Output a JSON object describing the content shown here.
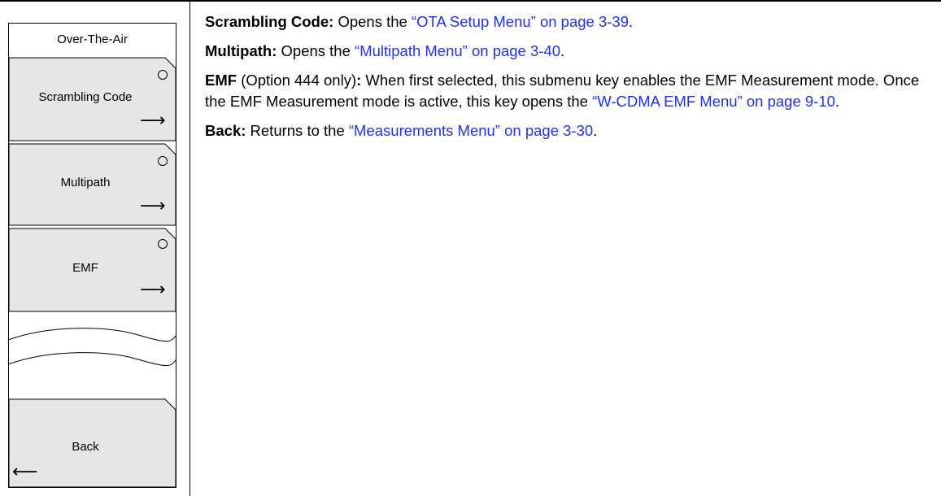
{
  "menu": {
    "title": "Over-The-Air",
    "keys": [
      {
        "label": "Scrambling Code",
        "arrow": "⟶"
      },
      {
        "label": "Multipath",
        "arrow": "⟶"
      },
      {
        "label": "EMF",
        "arrow": "⟶"
      }
    ],
    "back": {
      "label": "Back",
      "arrow": "⟵"
    }
  },
  "descriptions": {
    "scrambling": {
      "term": "Scrambling Code:",
      "text": " Opens the ",
      "link": "“OTA Setup Menu” on page 3-39",
      "end": "."
    },
    "multipath": {
      "term": "Multipath:",
      "text": " Opens the ",
      "link": "“Multipath Menu” on page 3-40",
      "end": "."
    },
    "emf": {
      "term": "EMF",
      "paren": " (Option 444 only)",
      "colon": ":",
      "text": " When first selected, this submenu key enables the EMF Measurement mode. Once the EMF Measurement mode is active, this key opens the ",
      "link": "“W-CDMA EMF Menu” on page 9-10",
      "end": "."
    },
    "back": {
      "term": "Back:",
      "text": " Returns to the ",
      "link": "“Measurements Menu” on page 3-30",
      "end": "."
    }
  }
}
